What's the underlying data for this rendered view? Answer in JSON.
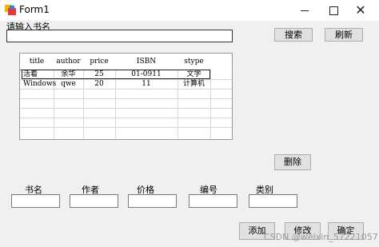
{
  "window": {
    "title": "Form1",
    "controls": {
      "minimize": "—",
      "maximize": "☐",
      "close": "✕"
    }
  },
  "search": {
    "label": "请输入书名",
    "value": ""
  },
  "buttons": {
    "search": "搜索",
    "refresh": "刷新",
    "delete": "删除",
    "add": "添加",
    "edit": "修改",
    "confirm": "确定"
  },
  "table": {
    "columns": [
      "title",
      "author",
      "price",
      "ISBN",
      "stype"
    ],
    "rows": [
      [
        "活着",
        "余华",
        "25",
        "01-0911",
        "文学"
      ],
      [
        "Windows",
        "qwe",
        "20",
        "11",
        "计算机"
      ]
    ]
  },
  "fields": {
    "title_label": "书名",
    "author_label": "作者",
    "price_label": "价格",
    "isbn_label": "编号",
    "type_label": "类别",
    "title_value": "",
    "author_value": "",
    "price_value": "",
    "isbn_value": "",
    "type_value": ""
  },
  "watermark": "CSDN @weixin_57221057"
}
